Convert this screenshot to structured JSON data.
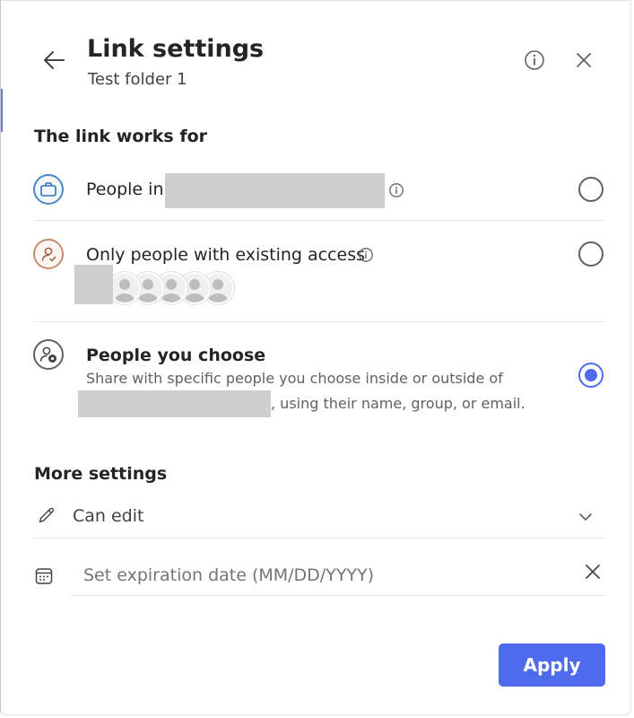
{
  "header": {
    "title": "Link settings",
    "subtitle": "Test folder 1"
  },
  "link_works_for": {
    "heading": "The link works for",
    "options": [
      {
        "label": "People in",
        "selected": false,
        "icon": "briefcase-icon"
      },
      {
        "label": "Only people with existing access",
        "selected": false,
        "icon": "person-sync-icon"
      },
      {
        "label": "People you choose",
        "selected": true,
        "icon": "people-settings-icon",
        "description_line1": "Share with specific people you choose inside or outside of",
        "description_line2": ", using their name, group, or email."
      }
    ]
  },
  "more_settings": {
    "heading": "More settings",
    "permission": "Can edit",
    "expiration_placeholder": "Set expiration date (MM/DD/YYYY)"
  },
  "footer": {
    "apply_label": "Apply"
  },
  "colors": {
    "accent": "#4f6bed",
    "briefcase_ring": "#4a88c7",
    "person_ring": "#c58d6f"
  }
}
